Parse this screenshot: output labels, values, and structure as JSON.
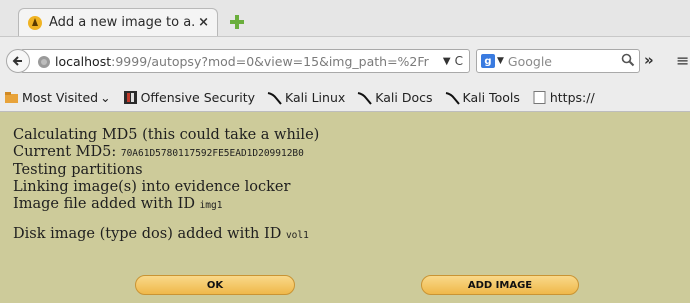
{
  "tab": {
    "title": "Add a new image to a...",
    "close": "×"
  },
  "navbar": {
    "url_host": "localhost",
    "url_rest": ":9999/autopsy?mod=0&view=15&img_path=%2Fr",
    "search_placeholder": "Google",
    "search_engine_letter": "g"
  },
  "bookmarks": [
    {
      "label": "Most Visited",
      "icon": "folder-icon",
      "suffix": "⌄"
    },
    {
      "label": "Offensive Security",
      "icon": "offsec-icon"
    },
    {
      "label": "Kali Linux",
      "icon": "kali-icon"
    },
    {
      "label": "Kali Docs",
      "icon": "kali-icon"
    },
    {
      "label": "Kali Tools",
      "icon": "kali-icon"
    },
    {
      "label": "https://",
      "icon": "blank-page-icon"
    }
  ],
  "log": {
    "line1": "Calculating MD5 (this could take a while)",
    "line2_label": "Current MD5: ",
    "line2_value": "70A61D5780117592FE5EAD1D209912B0",
    "line3": "Testing partitions",
    "line4": "Linking image(s) into evidence locker",
    "line5_label": "Image file added with ID ",
    "line5_value": "img1",
    "line6_label": "Disk image (type dos) added with ID ",
    "line6_value": "vol1"
  },
  "buttons": {
    "ok": "OK",
    "add_image": "ADD IMAGE"
  },
  "colors": {
    "content_bg": "#cdcb9a",
    "button": "#f2c15c"
  }
}
